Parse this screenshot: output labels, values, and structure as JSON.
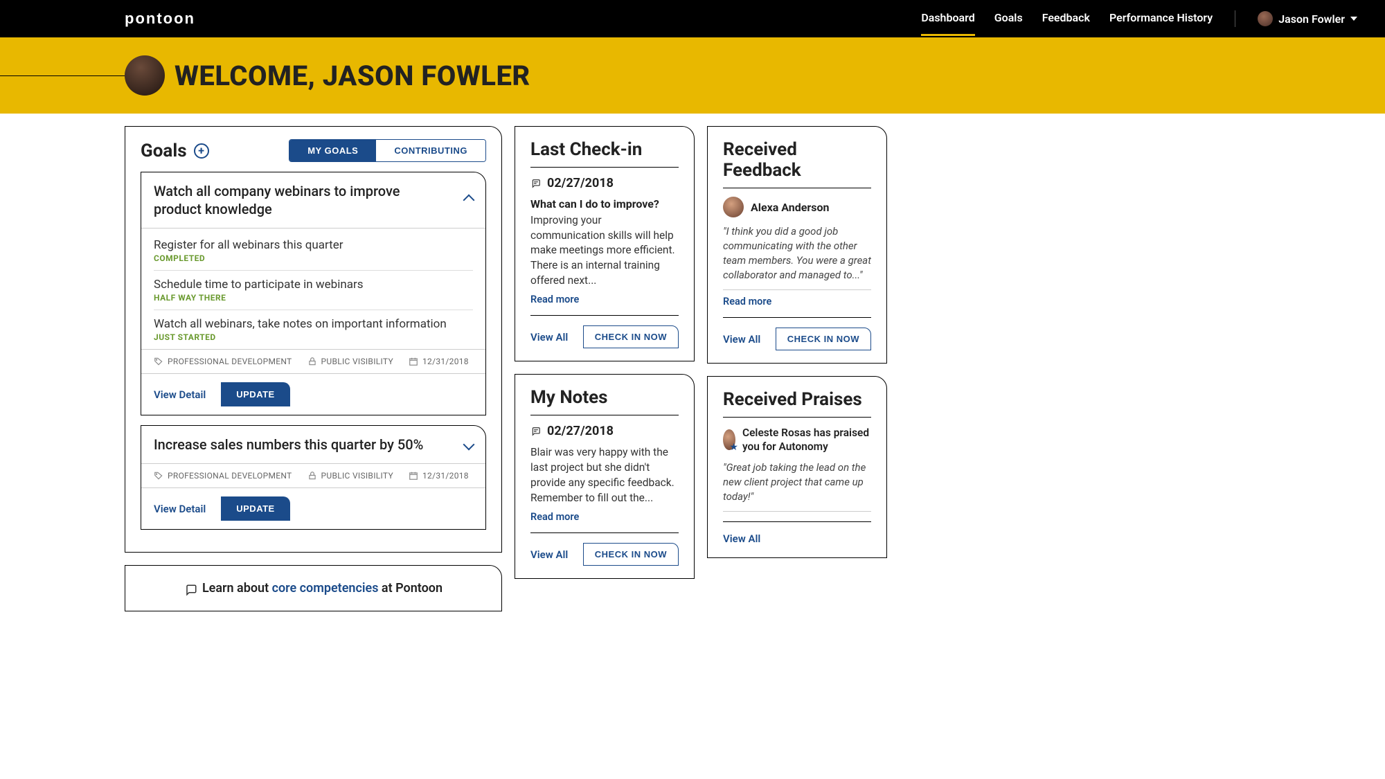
{
  "brand": "pontoon",
  "nav": {
    "items": [
      "Dashboard",
      "Goals",
      "Feedback",
      "Performance History"
    ],
    "activeIndex": 0,
    "user_name": "Jason Fowler"
  },
  "hero": {
    "welcome": "WELCOME, JASON FOWLER"
  },
  "goals": {
    "title": "Goals",
    "tabs": {
      "mine": "MY GOALS",
      "contrib": "CONTRIBUTING"
    },
    "items": [
      {
        "title": "Watch all company webinars to improve product knowledge",
        "expanded": true,
        "tasks": [
          {
            "text": "Register for all webinars this quarter",
            "status": "COMPLETED"
          },
          {
            "text": "Schedule time to participate in webinars",
            "status": "HALF WAY THERE"
          },
          {
            "text": "Watch all webinars, take notes on important information",
            "status": "JUST STARTED"
          }
        ],
        "meta": {
          "category": "PROFESSIONAL DEVELOPMENT",
          "visibility": "PUBLIC VISIBILITY",
          "due": "12/31/2018"
        },
        "view_detail": "View Detail",
        "update": "UPDATE"
      },
      {
        "title": "Increase sales numbers this quarter by 50%",
        "expanded": false,
        "meta": {
          "category": "PROFESSIONAL DEVELOPMENT",
          "visibility": "PUBLIC VISIBILITY",
          "due": "12/31/2018"
        },
        "view_detail": "View Detail",
        "update": "UPDATE"
      }
    ]
  },
  "learn": {
    "prefix": "Learn about ",
    "link": "core competencies",
    "suffix": " at Pontoon"
  },
  "checkin": {
    "title": "Last Check-in",
    "date": "02/27/2018",
    "question": "What can I do to improve?",
    "body": "Improving your communication skills will help make meetings more efficient. There is an internal training offered next...",
    "read_more": "Read more",
    "view_all": "View All",
    "cta": "CHECK IN NOW"
  },
  "notes": {
    "title": "My Notes",
    "date": "02/27/2018",
    "body": "Blair was very happy with the last project but she didn't provide any specific feedback. Remember to fill out the...",
    "read_more": "Read more",
    "view_all": "View All",
    "cta": "CHECK IN NOW"
  },
  "feedback": {
    "title": "Received Feedback",
    "person": "Alexa Anderson",
    "quote": "\"I think you did a good job communicating with the other team members. You were a great collaborator and managed to...\"",
    "read_more": "Read more",
    "view_all": "View All",
    "cta": "CHECK IN NOW"
  },
  "praises": {
    "title": "Received Praises",
    "headline": "Celeste Rosas has praised you for Autonomy",
    "quote": "\"Great job taking the lead on the new client project that came up today!\"",
    "view_all": "View All"
  }
}
